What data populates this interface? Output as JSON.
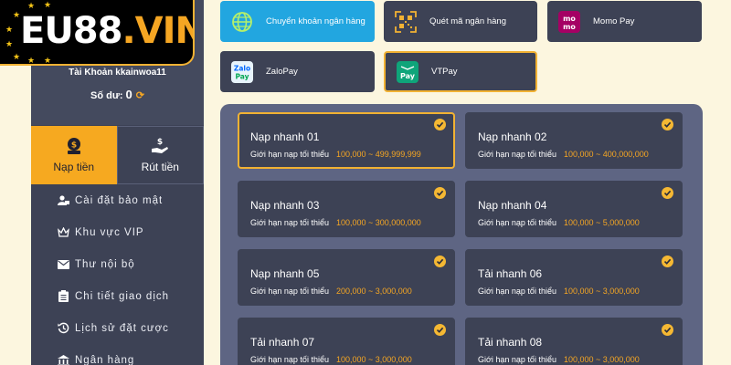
{
  "logo": {
    "part1": "EU88",
    "part2": ".VIN"
  },
  "account": {
    "name_line": "Tài Khoản kkainwoa11",
    "balance_label": "Số dư:",
    "balance_value": "0"
  },
  "tabs": [
    {
      "label": "Nạp tiền",
      "icon": "moneybag-icon"
    },
    {
      "label": "Rút tiền",
      "icon": "hand-money-icon"
    }
  ],
  "menu": [
    {
      "label": "Cài đặt bảo mật",
      "icon": "user-lock-icon"
    },
    {
      "label": "Khu vực VIP",
      "icon": "crown-icon"
    },
    {
      "label": "Thư nội bộ",
      "icon": "envelope-icon"
    },
    {
      "label": "Chi tiết giao dịch",
      "icon": "clipboard-icon"
    },
    {
      "label": "Lịch sử đặt cược",
      "icon": "history-icon"
    },
    {
      "label": "Ngân hàng",
      "icon": "bank-icon"
    }
  ],
  "payment_methods": [
    {
      "label": "Chuyển khoản ngân hàng",
      "icon": "globe-icon"
    },
    {
      "label": "Quét mã ngân hàng",
      "icon": "qr-icon"
    },
    {
      "label": "Momo Pay",
      "icon": "momo-logo",
      "icon_text": "mo mo"
    },
    {
      "label": "ZaloPay",
      "icon": "zalopay-logo",
      "icon_text": "Zalo Pay"
    },
    {
      "label": "VTPay",
      "icon": "vtpay-logo",
      "icon_text": "Pay"
    }
  ],
  "limit_label": "Giới hạn nạp tối thiểu",
  "options": [
    {
      "title": "Nạp nhanh 01",
      "range": "100,000 ~ 499,999,999"
    },
    {
      "title": "Nạp nhanh 02",
      "range": "100,000 ~ 400,000,000"
    },
    {
      "title": "Nạp nhanh 03",
      "range": "100,000 ~ 300,000,000"
    },
    {
      "title": "Nạp nhanh 04",
      "range": "100,000 ~ 5,000,000"
    },
    {
      "title": "Nạp nhanh 05",
      "range": "200,000 ~ 3,000,000"
    },
    {
      "title": "Tải nhanh 06",
      "range": "100,000 ~ 3,000,000"
    },
    {
      "title": "Tải nhanh 07",
      "range": "100,000 ~ 3,000,000"
    },
    {
      "title": "Tải nhanh 08",
      "range": "100,000 ~ 3,000,000"
    }
  ],
  "colors": {
    "accent": "#f6a920",
    "panel": "#5e6583",
    "card": "#3d4255",
    "selected_method": "#22a6e0"
  }
}
